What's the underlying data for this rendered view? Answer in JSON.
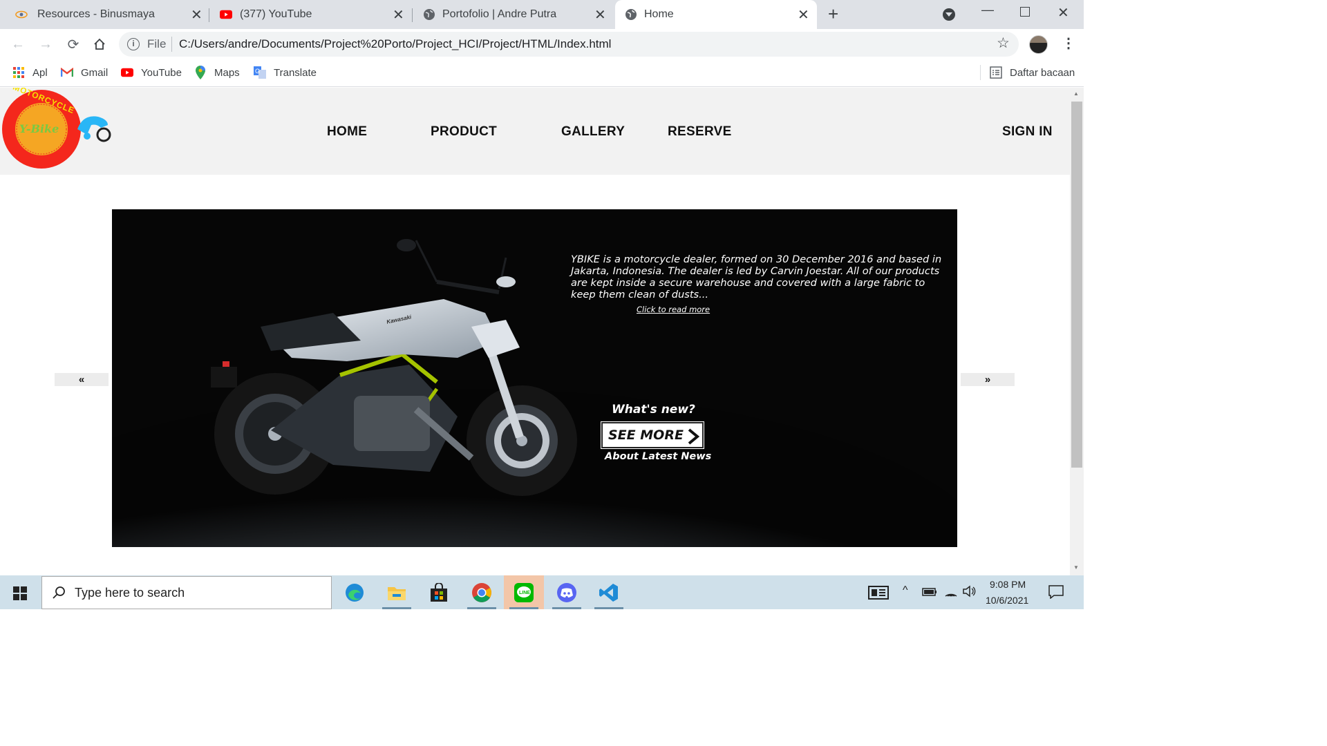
{
  "browser": {
    "tabs": [
      {
        "title": "Resources - Binusmaya",
        "icon": "binusmaya-icon"
      },
      {
        "title": "(377) YouTube",
        "icon": "youtube-icon"
      },
      {
        "title": "Portofolio | Andre Putra",
        "icon": "globe-icon"
      },
      {
        "title": "Home",
        "icon": "globe-icon",
        "active": true
      }
    ],
    "address": {
      "scheme_label": "File",
      "url": "C:/Users/andre/Documents/Project%20Porto/Project_HCI/Project/HTML/Index.html"
    },
    "bookmarks": [
      {
        "label": "Apl",
        "icon": "apps-grid-icon"
      },
      {
        "label": "Gmail",
        "icon": "gmail-icon"
      },
      {
        "label": "YouTube",
        "icon": "youtube-icon"
      },
      {
        "label": "Maps",
        "icon": "maps-pin-icon"
      },
      {
        "label": "Translate",
        "icon": "translate-icon"
      }
    ],
    "reading_list": "Daftar bacaan"
  },
  "site": {
    "logo": {
      "ring_text": "MOTORCYCLE",
      "center_text": "Y-Bike"
    },
    "nav": [
      {
        "label": "HOME"
      },
      {
        "label": "PRODUCT"
      },
      {
        "label": "GALLERY"
      },
      {
        "label": "RESERVE"
      }
    ],
    "signin": "SIGN IN",
    "slider": {
      "prev": "«",
      "next": "»",
      "description": "YBIKE is a motorcycle dealer, formed on 30 December 2016 and based in Jakarta, Indonesia. The dealer is led by Carvin Joestar. All of our products are kept inside a secure warehouse and covered with a large fabric to keep them clean of dusts...",
      "read_more": "Click to read more",
      "whats_new": "What's new?",
      "see_more": "SEE MORE",
      "latest_news": "About Latest News",
      "bike_brand": "Kawasaki"
    }
  },
  "taskbar": {
    "search_placeholder": "Type here to search",
    "time": "9:08 PM",
    "date": "10/6/2021"
  },
  "colors": {
    "logo_red": "#f4271c",
    "logo_yellow": "#f5a623",
    "logo_green": "#7ac943",
    "bike_blue": "#29b6f6"
  }
}
